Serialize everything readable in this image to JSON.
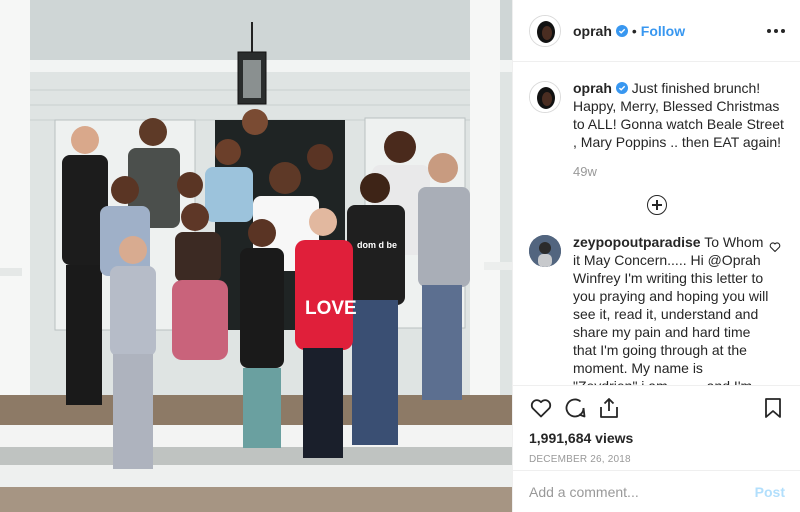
{
  "post": {
    "author": "oprah",
    "follow_label": "Follow",
    "separator": "•"
  },
  "caption": {
    "author": "oprah",
    "text": " Just finished brunch! Happy, Merry, Blessed Christmas to ALL! Gonna watch Beale Street , Mary Poppins .. then EAT again!",
    "time": "49w"
  },
  "comments": [
    {
      "author": "zeypopoutparadise",
      "text": " To Whom it May Concern..... Hi @Oprah Winfrey I'm writing this letter to you praying and hoping you will see it, read it, understand and share my pain and hard time that I'm going through at the moment. My name is \"Zeydrien\" i am_____and I'm from Florida. I consider myself to"
    }
  ],
  "stats": {
    "views": "1,991,684 views",
    "date": "December 26, 2018"
  },
  "composer": {
    "placeholder": "Add a comment...",
    "post_label": "Post"
  },
  "photo": {
    "shirt_text_love": "LOVE",
    "shirt_text_wisdom": "dom d be"
  },
  "colors": {
    "link": "#3897f0",
    "post_disabled": "#b2dffc",
    "muted": "#999999",
    "border": "#efefef"
  },
  "icons": [
    "more-options-icon",
    "verified-badge-icon",
    "load-more-icon",
    "heart-icon",
    "comment-icon",
    "share-icon",
    "bookmark-icon"
  ]
}
